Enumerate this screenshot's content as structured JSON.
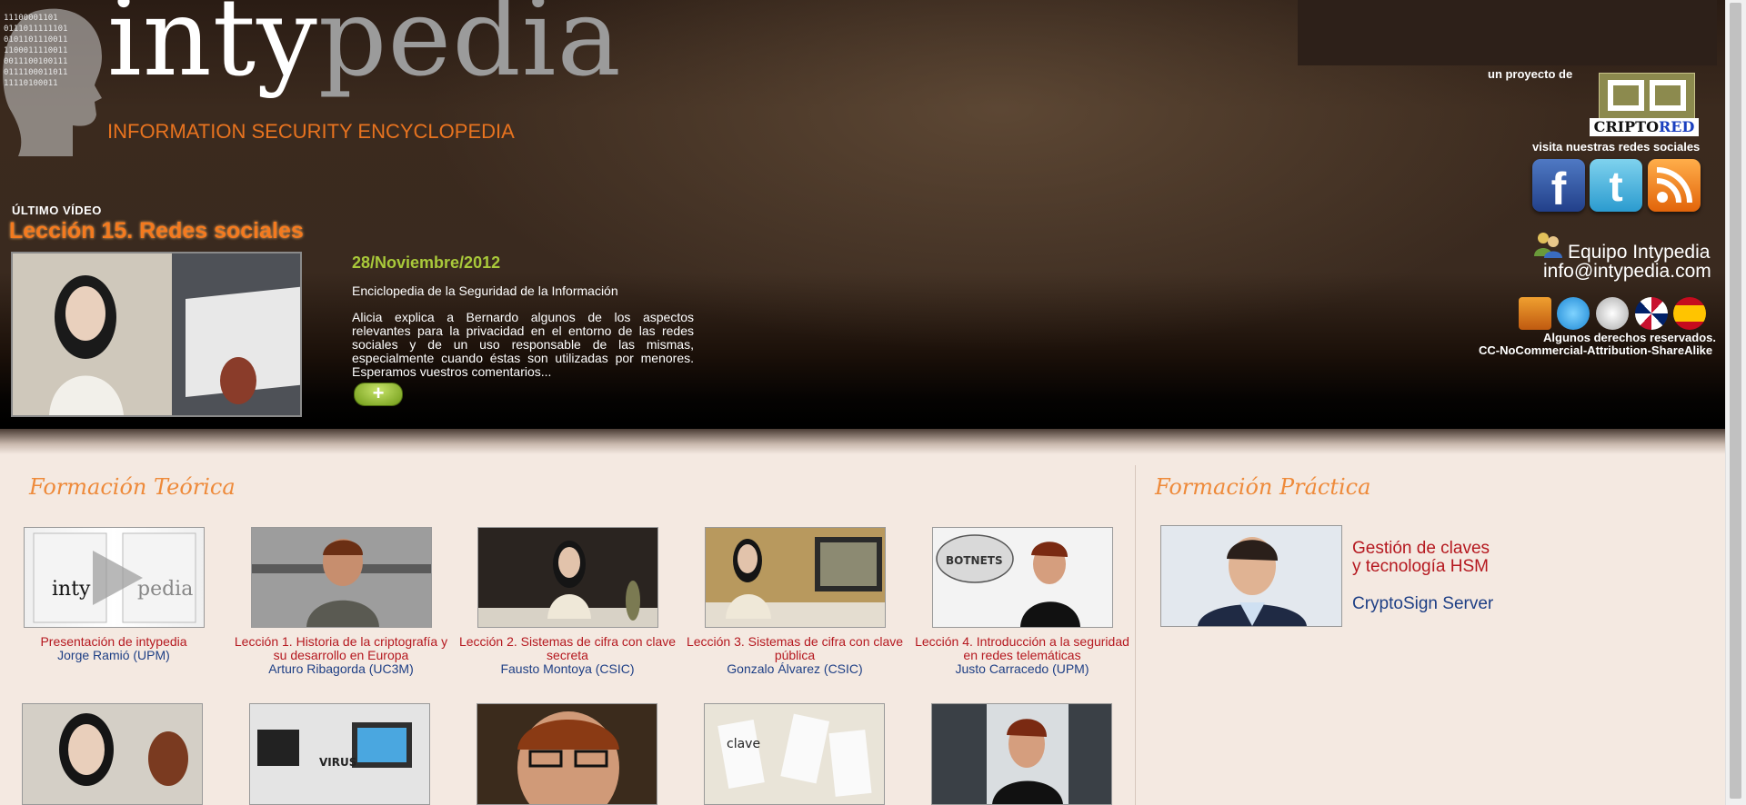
{
  "header": {
    "logo_inty": "inty",
    "logo_pedia": "pedia",
    "logo_subtitle": "INFORMATION SECURITY ENCYCLOPEDIA",
    "latest_label": "ÚLTIMO VÍDEO",
    "latest_title": "Lección 15. Redes sociales",
    "latest_date": "28/Noviembre/2012",
    "latest_encyclopedia": "Enciclopedia de la Seguridad de la Información",
    "latest_description": "Alicia explica a Bernardo algunos de los aspectos relevantes para la privacidad en el entorno de las redes sociales y de un uso responsable de las mismas, especialmente cuando éstas son utilizadas por menores. Esperamos vuestros comentarios...",
    "more_label": "+",
    "project_label": "un proyecto de",
    "criptored_part1": "CRIPTO",
    "criptored_part2": "RED",
    "social_label": "visita nuestras redes sociales",
    "facebook_glyph": "f",
    "twitter_glyph": "t",
    "team_name": "Equipo Intypedia",
    "team_email": "info@intypedia.com",
    "rights": "Algunos derechos reservados.",
    "license": "CC-NoCommercial-Attribution-ShareAlike"
  },
  "teorica": {
    "title": "Formación Teórica",
    "lessons": [
      {
        "title": "Presentación de intypedia",
        "author": "Jorge Ramió (UPM)"
      },
      {
        "title": "Lección 1. Historia de la criptografía y su desarrollo en Europa",
        "author": "Arturo Ribagorda (UC3M)"
      },
      {
        "title": "Lección 2. Sistemas de cifra con clave secreta",
        "author": "Fausto Montoya (CSIC)"
      },
      {
        "title": "Lección 3. Sistemas de cifra con clave pública",
        "author": "Gonzalo Álvarez (CSIC)"
      },
      {
        "title": "Lección 4. Introducción a la seguridad en redes telemáticas",
        "author": "Justo Carracedo (UPM)"
      }
    ],
    "thumb_labels": {
      "intro_inty": "inty",
      "intro_pedia": "pedia",
      "botnets": "BOTNETS",
      "virus": "VIRUS",
      "clave": "clave"
    }
  },
  "practica": {
    "title": "Formación Práctica",
    "item_title_1": "Gestión de claves",
    "item_title_2": "y tecnología HSM",
    "item_sub": "CryptoSign Server"
  }
}
